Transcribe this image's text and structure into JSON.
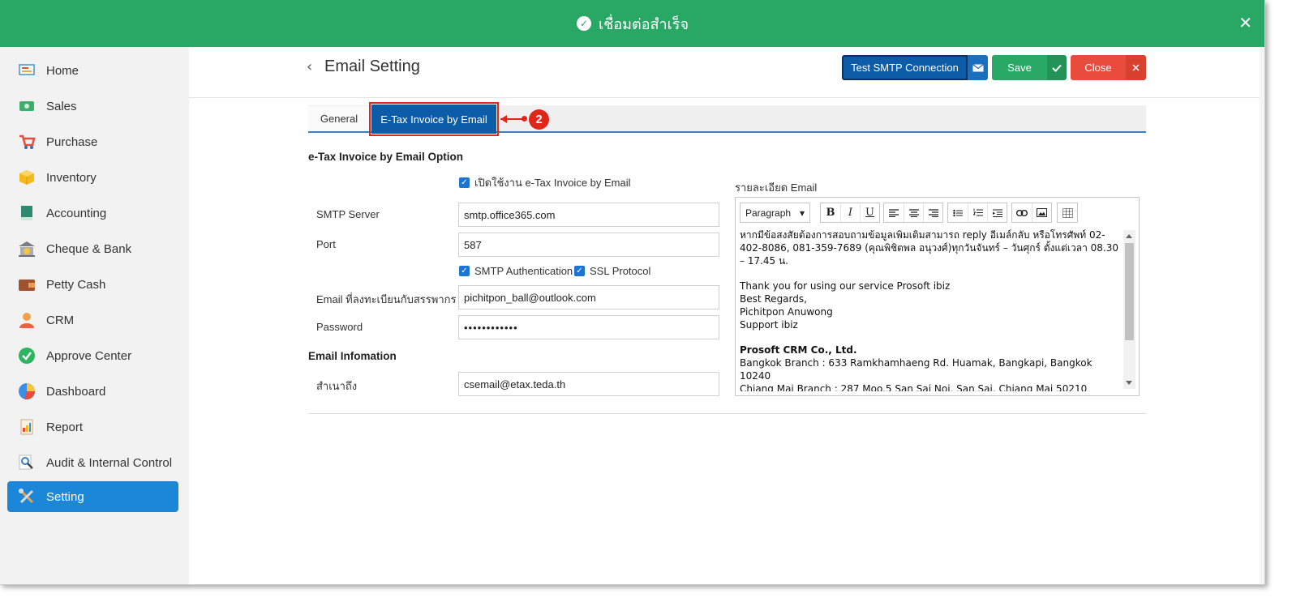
{
  "toast": {
    "message": "เชื่อมต่อสำเร็จ",
    "close": "✕",
    "color": "#28a765"
  },
  "sidebar": {
    "items": [
      {
        "label": "Home",
        "icon": "home-icon"
      },
      {
        "label": "Sales",
        "icon": "sales-icon"
      },
      {
        "label": "Purchase",
        "icon": "cart-icon"
      },
      {
        "label": "Inventory",
        "icon": "box-icon"
      },
      {
        "label": "Accounting",
        "icon": "book-icon"
      },
      {
        "label": "Cheque & Bank",
        "icon": "bank-icon"
      },
      {
        "label": "Petty Cash",
        "icon": "wallet-icon"
      },
      {
        "label": "CRM",
        "icon": "crm-icon"
      },
      {
        "label": "Approve Center",
        "icon": "check-circle-icon"
      },
      {
        "label": "Dashboard",
        "icon": "pie-chart-icon"
      },
      {
        "label": "Report",
        "icon": "report-icon"
      },
      {
        "label": "Audit & Internal Control",
        "icon": "magnifier-icon"
      },
      {
        "label": "Setting",
        "icon": "tools-icon",
        "active": true
      }
    ],
    "active_color": "#1c87d8"
  },
  "header": {
    "back": "‹",
    "title": "Email Setting",
    "test_label": "Test SMTP Connection",
    "save_label": "Save",
    "close_label": "Close"
  },
  "tabs": {
    "general": "General",
    "etax": "E-Tax Invoice by Email",
    "step": "2"
  },
  "form": {
    "option_heading": "e-Tax Invoice by Email Option",
    "enable_label": "เปิดใช้งาน e-Tax Invoice by Email",
    "smtp_server_label": "SMTP Server",
    "smtp_server_value": "smtp.office365.com",
    "port_label": "Port",
    "port_value": "587",
    "smtp_auth_label": "SMTP Authentication",
    "ssl_label": "SSL Protocol",
    "email_label": "Email ที่ลงทะเบียนกับสรรพากร",
    "email_value": "pichitpon_ball@outlook.com",
    "password_label": "Password",
    "password_value": "••••••••••••",
    "info_heading": "Email Infomation",
    "cc_label": "สำเนาถึง",
    "cc_value": "csemail@etax.teda.th"
  },
  "editor": {
    "label": "รายละเอียด Email",
    "paragraph": "Paragraph",
    "content": {
      "p1": "หากมีข้อสงสัยต้องการสอบถามข้อมูลเพิ่มเติมสามารถ reply อีเมล์กลับ หรือโทรศัพท์ 02-402-8086, 081-359-7689 (คุณพิชิตพล อนุวงศ์)ทุกวันจันทร์ – วันศุกร์ ตั้งแต่เวลา 08.30 – 17.45 น.",
      "p2": "Thank you for using our service Prosoft ibiz\nBest Regards,\nPichitpon Anuwong\nSupport ibiz",
      "company": "Prosoft CRM Co., Ltd.",
      "branches": "Bangkok Branch : 633 Ramkhamhaeng Rd. Huamak, Bangkapi, Bangkok 10240\nChiang Mai Branch : 287 Moo.5 San Sai Noi, San Sai, Chiang Mai 50210"
    }
  }
}
